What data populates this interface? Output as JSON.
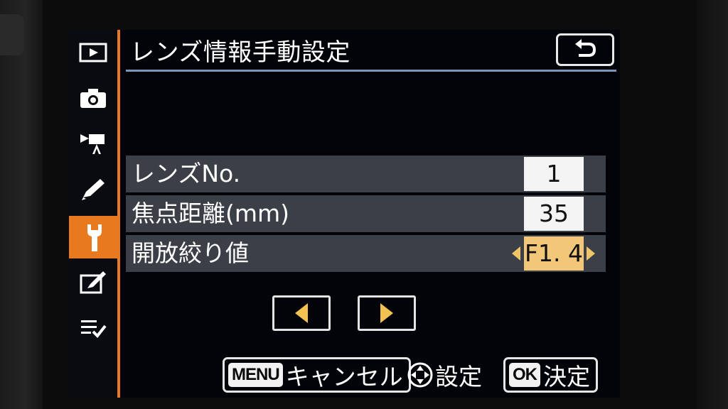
{
  "title": "レンズ情報手動設定",
  "back_icon": "return-arrow-icon",
  "sidebar": {
    "items": [
      {
        "icon": "playback-icon",
        "active": false
      },
      {
        "icon": "camera-icon",
        "active": false
      },
      {
        "icon": "movie-camera-icon",
        "active": false
      },
      {
        "icon": "pencil-icon",
        "active": false
      },
      {
        "icon": "wrench-icon",
        "active": true
      },
      {
        "icon": "retouch-icon",
        "active": false
      },
      {
        "icon": "my-menu-icon",
        "active": false
      }
    ],
    "accent_color": "#e8791f"
  },
  "rows": [
    {
      "label": "レンズNo.",
      "value": "1"
    },
    {
      "label": "焦点距離(mm)",
      "value": "35"
    },
    {
      "label": "開放絞り値",
      "value": "F1. 4"
    }
  ],
  "nav": {
    "left_icon": "left-arrow-icon",
    "right_icon": "right-arrow-icon"
  },
  "footer": {
    "cancel_badge": "MENU",
    "cancel_label": "キャンセル",
    "set_icon": "multi-selector-icon",
    "set_label": "設定",
    "ok_badge": "OK",
    "ok_label": "決定"
  },
  "colors": {
    "selected_value": "#f3c77a",
    "row_background": "#3b3f47",
    "title_rule": "#7f95b8"
  }
}
